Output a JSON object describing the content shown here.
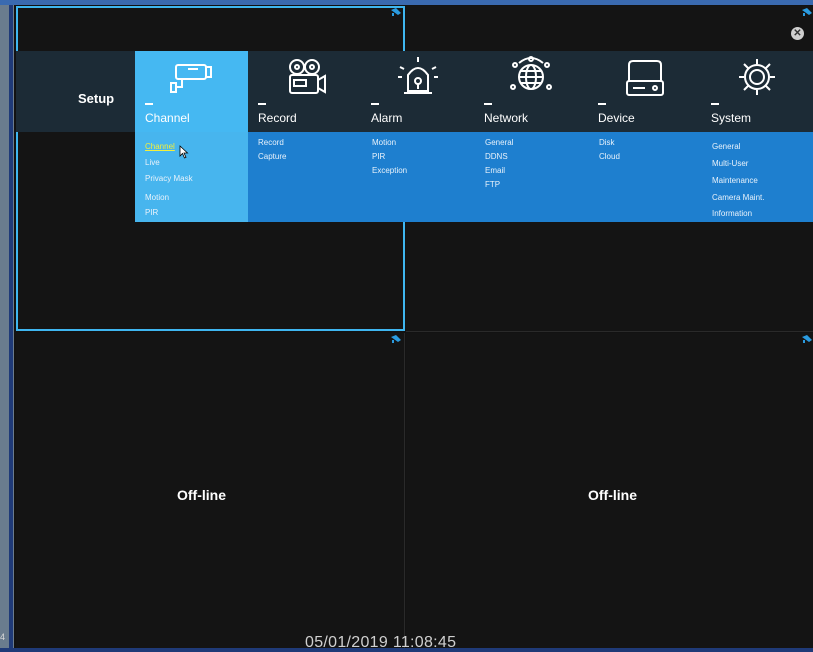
{
  "setup_label": "Setup",
  "menu": [
    {
      "label": "Channel",
      "icon": "camera-icon",
      "active": true,
      "items": [
        "Channel",
        "Live",
        "Privacy Mask",
        "Motion",
        "PIR"
      ]
    },
    {
      "label": "Record",
      "icon": "film-camera-icon",
      "active": false,
      "items": [
        "Record",
        "Capture"
      ]
    },
    {
      "label": "Alarm",
      "icon": "siren-icon",
      "active": false,
      "items": [
        "Motion",
        "PIR",
        "Exception"
      ]
    },
    {
      "label": "Network",
      "icon": "globe-icon",
      "active": false,
      "items": [
        "General",
        "DDNS",
        "Email",
        "FTP"
      ]
    },
    {
      "label": "Device",
      "icon": "hard-drive-icon",
      "active": false,
      "items": [
        "Disk",
        "Cloud"
      ]
    },
    {
      "label": "System",
      "icon": "gear-icon",
      "active": false,
      "items": [
        "General",
        "Multi-User",
        "Maintenance",
        "Camera Maint.",
        "Information"
      ]
    }
  ],
  "cells": {
    "cell3_status": "Off-line",
    "cell4_status": "Off-line"
  },
  "channel_number": "4",
  "timestamp": "05/01/2019 11:08:45",
  "colors": {
    "active_tab": "#45b8f2",
    "submenu_bg": "#1e7fcf",
    "highlight_text": "#f4ef3a",
    "selected_cell_border": "#3fb6f0"
  }
}
